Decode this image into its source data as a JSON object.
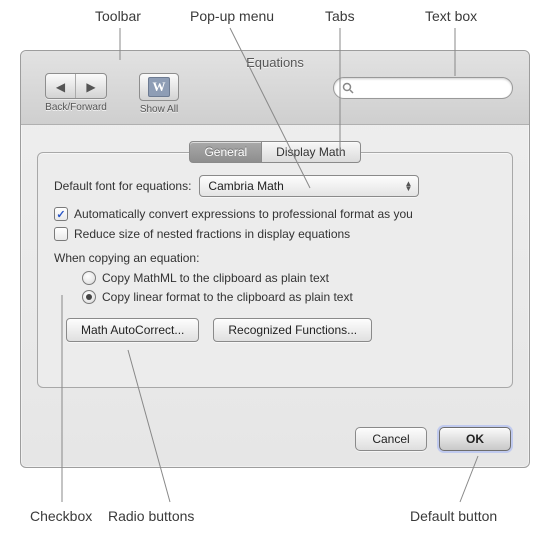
{
  "callouts": {
    "toolbar": "Toolbar",
    "popup": "Pop-up menu",
    "tabs": "Tabs",
    "textbox": "Text box",
    "checkbox": "Checkbox",
    "radio": "Radio buttons",
    "default_button": "Default button"
  },
  "window": {
    "title": "Equations",
    "toolbar": {
      "back_tooltip": "◀",
      "fwd_tooltip": "▶",
      "backfwd_label": "Back/Forward",
      "showall_label": "Show All",
      "showall_glyph": "W"
    },
    "search": {
      "placeholder": ""
    }
  },
  "tabs": [
    {
      "label": "General",
      "active": true
    },
    {
      "label": "Display Math",
      "active": false
    }
  ],
  "pane": {
    "font_label": "Default font for equations:",
    "font_value": "Cambria Math",
    "check_auto": {
      "checked": true,
      "label": "Automatically convert expressions to professional format as you"
    },
    "check_reduce": {
      "checked": false,
      "label": "Reduce size of nested fractions in display equations"
    },
    "copy_section": "When copying an equation:",
    "radio_mathml": {
      "selected": false,
      "label": "Copy MathML to the clipboard as plain text"
    },
    "radio_linear": {
      "selected": true,
      "label": "Copy linear format to the clipboard as plain text"
    },
    "btn_autocorrect": "Math AutoCorrect...",
    "btn_recognized": "Recognized Functions..."
  },
  "footer": {
    "cancel": "Cancel",
    "ok": "OK"
  }
}
